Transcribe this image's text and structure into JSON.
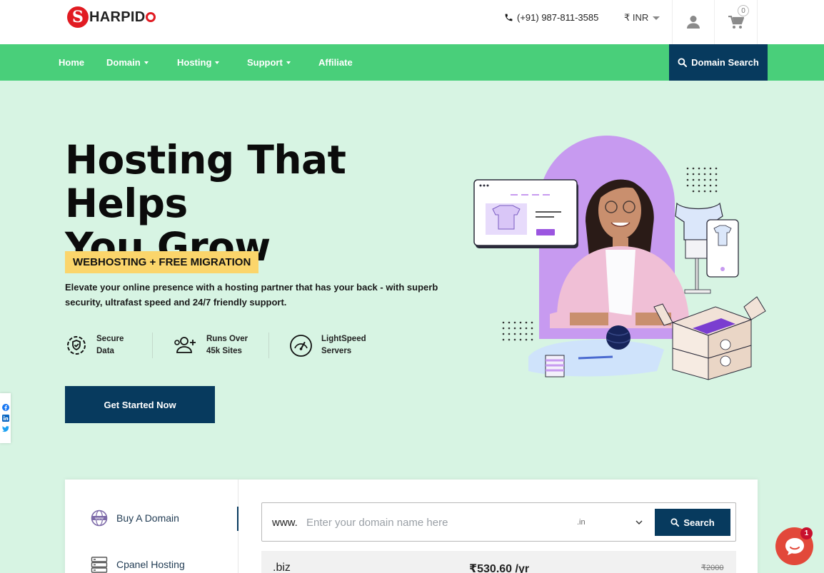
{
  "brand": {
    "name": "HARPID",
    "initial": "S"
  },
  "header": {
    "phone": "(+91) 987-811-3585",
    "currency": "₹ INR",
    "cart_count": "0"
  },
  "nav": {
    "items": [
      {
        "label": "Home",
        "dropdown": false
      },
      {
        "label": "Domain",
        "dropdown": true
      },
      {
        "label": "Hosting",
        "dropdown": true
      },
      {
        "label": "Support",
        "dropdown": true
      },
      {
        "label": "Affiliate",
        "dropdown": false
      }
    ],
    "domain_search": "Domain Search"
  },
  "hero": {
    "title_line1": "Hosting That Helps",
    "title_line2": "You Grow",
    "badge": "WEBHOSTING + FREE MIGRATION",
    "description": "Elevate your online presence with a hosting partner that has your back - with superb security, ultrafast speed and 24/7 friendly support.",
    "features": [
      {
        "line1": "Secure",
        "line2": "Data",
        "icon": "shield-gear-icon"
      },
      {
        "line1": "Runs Over",
        "line2": "45k Sites",
        "icon": "users-add-icon"
      },
      {
        "line1": "LightSpeed",
        "line2": "Servers",
        "icon": "speedometer-icon"
      }
    ],
    "cta": "Get Started Now"
  },
  "domain_panel": {
    "tabs": [
      {
        "label": "Buy A Domain",
        "icon": "globe-www-icon"
      },
      {
        "label": "Cpanel Hosting",
        "icon": "server-icon"
      }
    ],
    "prefix": "www.",
    "placeholder": "Enter your domain name here",
    "tld_selected": ".in",
    "search_label": "Search",
    "tld_row": {
      "tld": ".biz",
      "price": "₹530.60 /yr",
      "old_price": "₹2000"
    }
  },
  "chat": {
    "badge": "1"
  },
  "colors": {
    "green": "#49cf7a",
    "navy": "#073a5e",
    "mint_bg": "#d7f4e3",
    "badge_yellow": "#fbd56b",
    "brand_red": "#e11b22",
    "purple": "#c79af0"
  }
}
